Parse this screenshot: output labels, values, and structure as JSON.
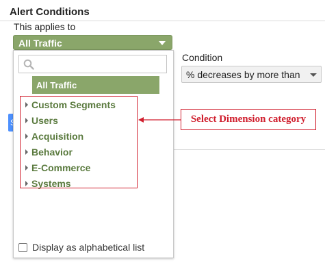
{
  "section": {
    "title": "Alert Conditions"
  },
  "applies_to": {
    "label": "This applies to",
    "selected": "All Traffic",
    "search_placeholder": "",
    "highlighted_item": "All Traffic",
    "categories": [
      "Custom Segments",
      "Users",
      "Acquisition",
      "Behavior",
      "E-Commerce",
      "Systems"
    ],
    "alphabetical_label": "Display as alphabetical list",
    "alphabetical_checked": false
  },
  "condition": {
    "label": "Condition",
    "selected": "% decreases by more than"
  },
  "hidden_button": {
    "label": "S"
  },
  "annotation": {
    "text": "Select Dimension category"
  },
  "colors": {
    "accent_green": "#8aa66a",
    "annotation_red": "#d01f2e",
    "category_text": "#5a7a3e",
    "button_blue": "#4d90fe"
  }
}
